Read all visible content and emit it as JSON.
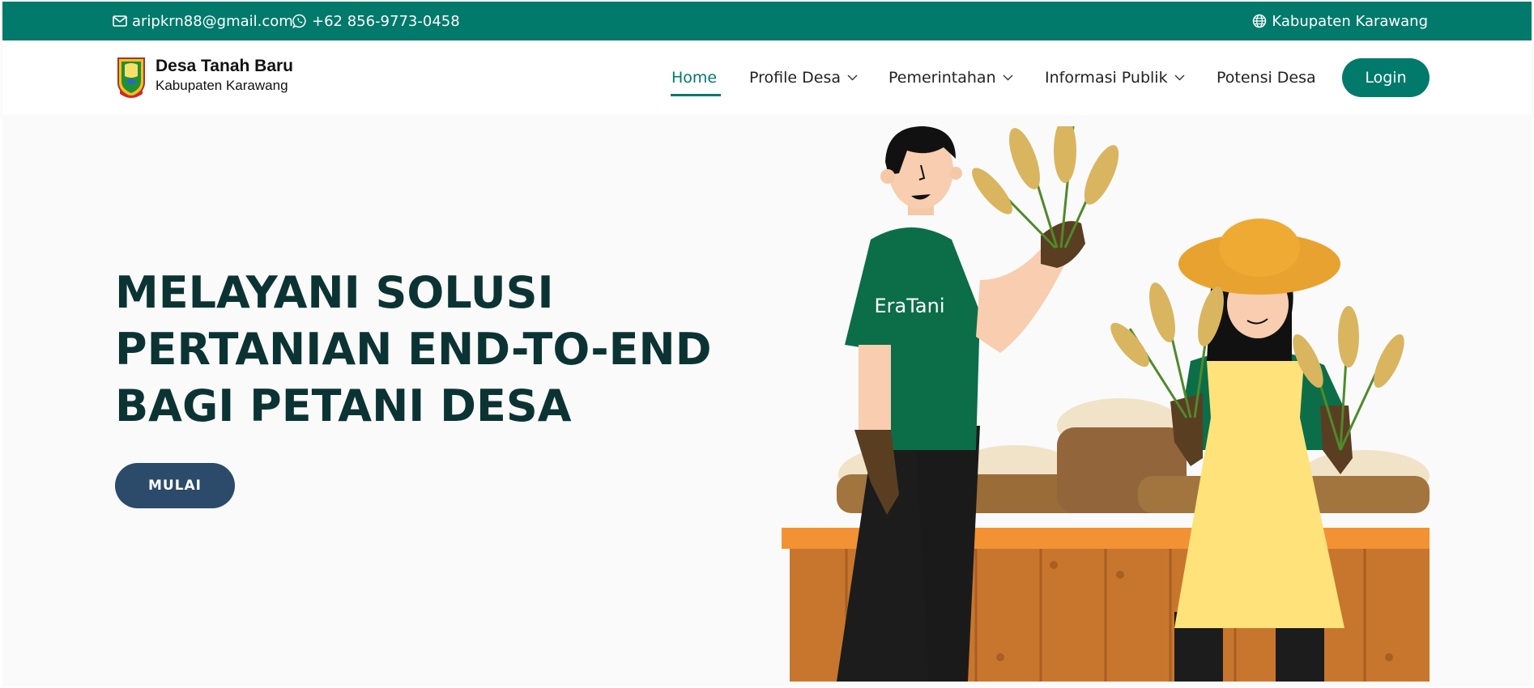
{
  "topbar": {
    "email": "aripkrn88@gmail.com",
    "phone": "+62 856-9773-0458",
    "region": "Kabupaten Karawang"
  },
  "brand": {
    "title": "Desa Tanah Baru",
    "subtitle": "Kabupaten Karawang"
  },
  "nav": {
    "items": [
      {
        "label": "Home",
        "active": true
      },
      {
        "label": "Profile Desa",
        "dropdown": true
      },
      {
        "label": "Pemerintahan",
        "dropdown": true
      },
      {
        "label": "Informasi Publik",
        "dropdown": true
      },
      {
        "label": "Potensi Desa"
      }
    ],
    "login_label": "Login"
  },
  "hero": {
    "title_lines": [
      "MELAYANI SOLUSI",
      "PERTANIAN END-TO-END",
      "BAGI PETANI DESA"
    ],
    "cta_label": "MULAI",
    "shirt_logo": "EraTani"
  },
  "colors": {
    "primary": "#017a6b",
    "hero_text": "#0c3333",
    "cta": "#2c4a69",
    "hero_bg": "#fafafa"
  },
  "icons": [
    "envelope-icon",
    "whatsapp-icon",
    "globe-icon",
    "chevron-down-icon"
  ]
}
